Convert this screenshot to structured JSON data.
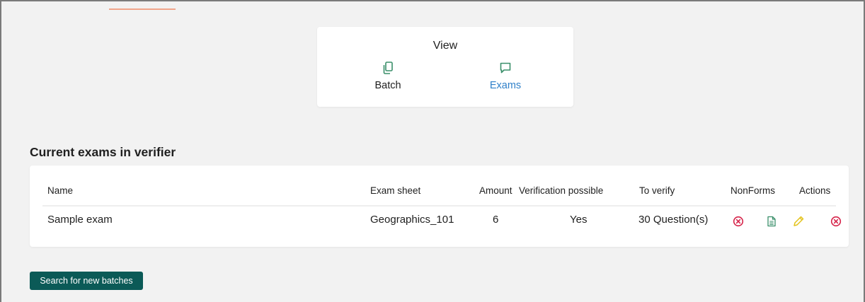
{
  "view_toggle": {
    "title": "View",
    "options": [
      {
        "label": "Batch",
        "icon": "copy-icon",
        "active": false
      },
      {
        "label": "Exams",
        "icon": "message-square-icon",
        "active": true
      }
    ]
  },
  "section": {
    "title": "Current exams in verifier"
  },
  "table": {
    "columns": {
      "name": "Name",
      "exam_sheet": "Exam sheet",
      "amount": "Amount",
      "verification_possible": "Verification possible",
      "to_verify": "To verify",
      "nonforms": "NonForms",
      "actions": "Actions"
    },
    "rows": [
      {
        "name": "Sample exam",
        "exam_sheet": "Geographics_101",
        "amount": "6",
        "verification_possible": "Yes",
        "to_verify": "30 Question(s)",
        "nonforms_icons": [
          "close-circle-icon",
          "document-icon"
        ],
        "action_icons": [
          "pencil-icon",
          "close-circle-icon"
        ]
      }
    ]
  },
  "search_button": {
    "label": "Search for new batches"
  },
  "colors": {
    "accent_blue": "#2f80c9",
    "icon_green": "#3a8f6a",
    "delete_red": "#d6244a",
    "edit_yellow": "#e3c21b",
    "button_teal": "#0b5a57",
    "tab_underline": "#f0a58a"
  }
}
